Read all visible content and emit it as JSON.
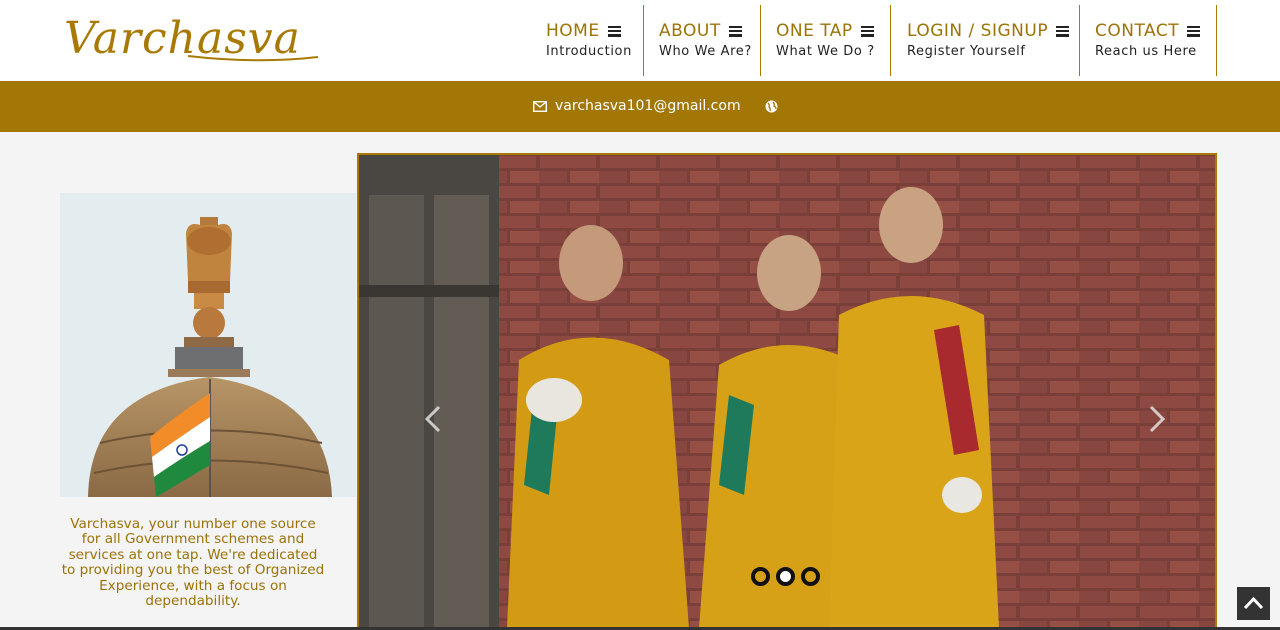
{
  "brand": {
    "logo_text": "Varchasva"
  },
  "nav": [
    {
      "title": "HOME",
      "subtitle": "Introduction"
    },
    {
      "title": "ABOUT",
      "subtitle": "Who We Are?"
    },
    {
      "title": "ONE TAP",
      "subtitle": "What We Do ?"
    },
    {
      "title": "LOGIN / SIGNUP",
      "subtitle": "Register Yourself"
    },
    {
      "title": "CONTACT",
      "subtitle": "Reach us Here"
    }
  ],
  "contact_bar": {
    "email": "varchasva101@gmail.com"
  },
  "about": {
    "text": "Varchasva, your number one source for all Government schemes and services at one tap. We're dedicated to providing you the best of Organized Experience, with a focus on dependability."
  },
  "slider": {
    "slide_count": 3,
    "active_slide": 2
  },
  "icons": [
    "menu-icon",
    "mail-icon",
    "globe-icon",
    "chevron-left-icon",
    "chevron-right-icon",
    "arrow-up-icon"
  ],
  "colors": {
    "brand_gold": "#a37706",
    "header_bg": "#ffffff",
    "page_bg": "#f4f4f4",
    "text_dark": "#222222"
  }
}
